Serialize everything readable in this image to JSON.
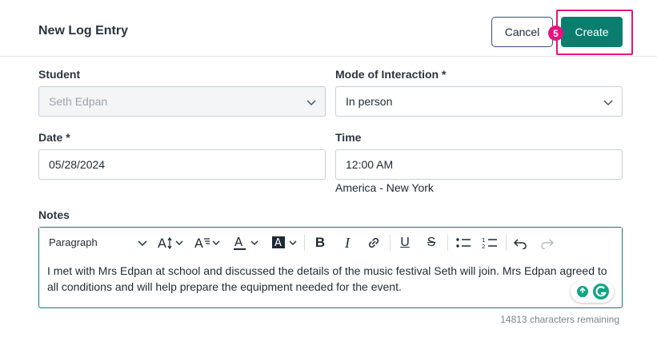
{
  "header": {
    "title": "New Log Entry",
    "cancel_label": "Cancel",
    "create_label": "Create",
    "step_badge": "5"
  },
  "form": {
    "student": {
      "label": "Student",
      "value": "Seth Edpan"
    },
    "mode": {
      "label": "Mode of Interaction *",
      "value": "In person"
    },
    "date": {
      "label": "Date *",
      "value": "05/28/2024"
    },
    "time": {
      "label": "Time",
      "value": "12:00 AM",
      "timezone": "America - New York"
    },
    "notes": {
      "label": "Notes",
      "paragraph_style": "Paragraph",
      "text": "I met with Mrs Edpan at school and discussed the details of the music festival Seth will join. Mrs Edpan agreed to all conditions and will help prepare the equipment needed for the event.",
      "remaining": "14813 characters remaining"
    }
  },
  "colors": {
    "primary": "#0b7d6e",
    "highlight": "#e6127f"
  }
}
